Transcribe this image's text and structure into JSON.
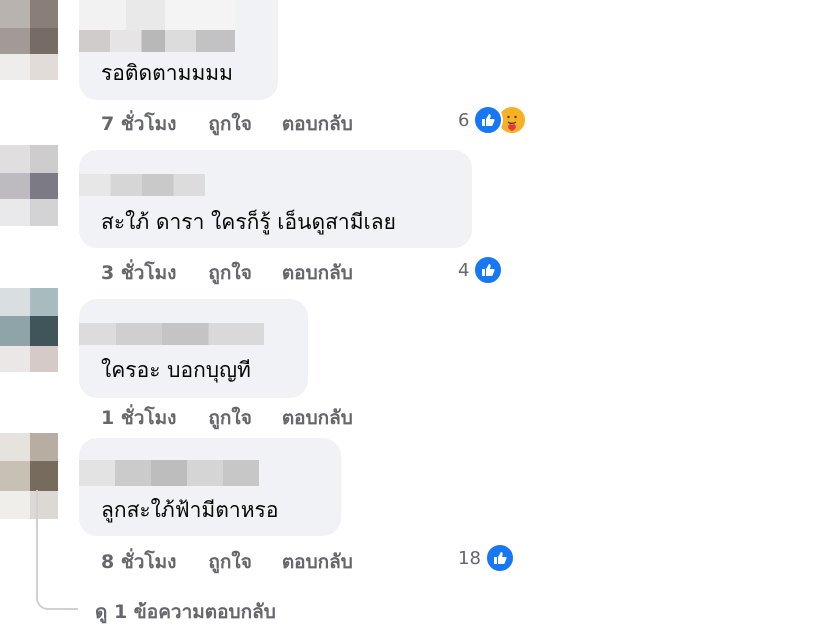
{
  "comments": [
    {
      "text": "รอติดตามมมม",
      "time": "7 ชั่วโมง",
      "like": "ถูกใจ",
      "reply": "ตอบกลับ",
      "reactions": "6"
    },
    {
      "text": "สะใภ้ ดารา ใครก็รู้ เอ็นดูสามีเลย",
      "time": "3 ชั่วโมง",
      "like": "ถูกใจ",
      "reply": "ตอบกลับ",
      "reactions": "4"
    },
    {
      "text": "ใครอะ บอกบุญที",
      "time": "1 ชั่วโมง",
      "like": "ถูกใจ",
      "reply": "ตอบกลับ",
      "reactions": ""
    },
    {
      "text": "ลูกสะใภ้ฟ้ามีตาหรอ",
      "time": "8 ชั่วโมง",
      "like": "ถูกใจ",
      "reply": "ตอบกลับ",
      "reactions": "18"
    }
  ],
  "view_replies": "ดู 1 ข้อความตอบกลับ",
  "icons": {
    "like_reaction": "thumbs-up-icon",
    "care_reaction": "care-emoji-icon"
  },
  "colors": {
    "bubble": "#f0f2f5",
    "like_blue": "#1877f2",
    "meta_text": "#65676b",
    "text": "#050505"
  }
}
